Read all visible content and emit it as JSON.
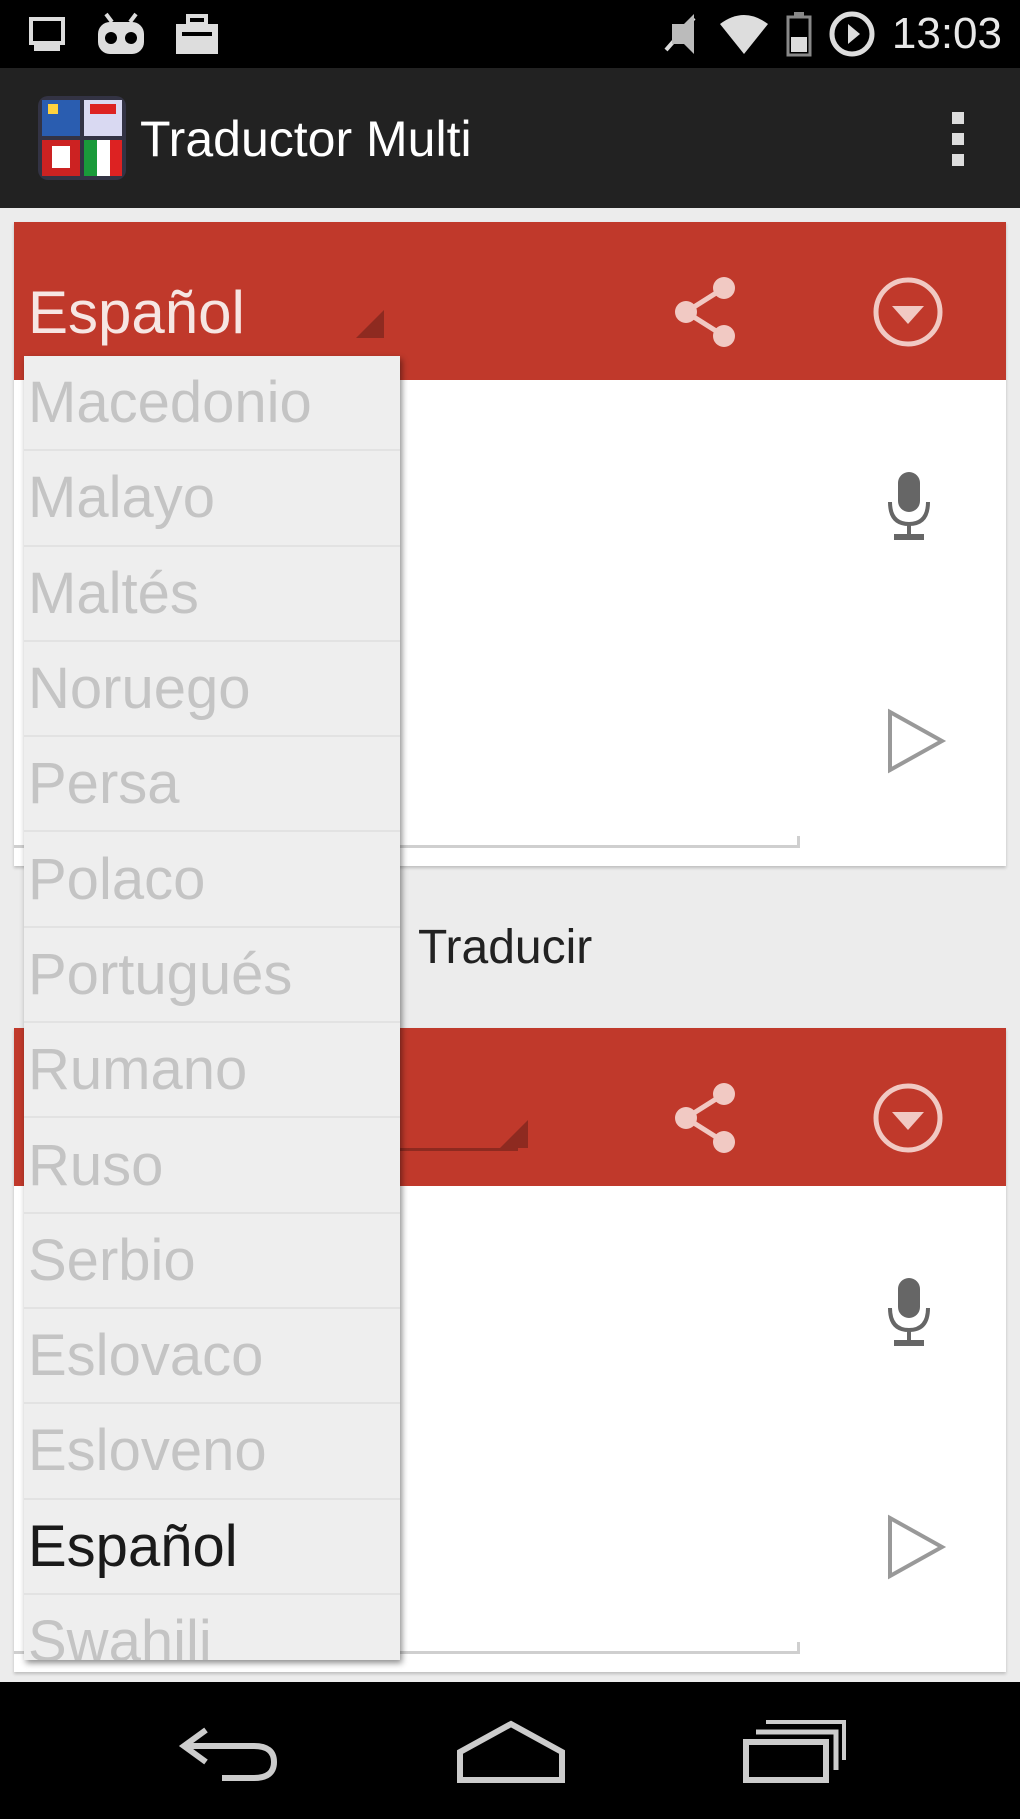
{
  "status_bar": {
    "time": "13:03",
    "icons": [
      "monitor-icon",
      "android-debug-icon",
      "briefcase-icon",
      "mute-icon",
      "wifi-icon",
      "battery-icon",
      "data-saver-icon"
    ]
  },
  "app_bar": {
    "title": "Traductor Multi",
    "icon": "flags-app-icon"
  },
  "source_panel": {
    "language": "Español",
    "share_icon": "share-icon",
    "dropdown_icon": "dropdown-circle-icon",
    "mic_icon": "microphone-icon",
    "play_icon": "play-icon"
  },
  "translate_button": {
    "label": "Traducir"
  },
  "target_panel": {
    "language": "",
    "share_icon": "share-icon",
    "dropdown_icon": "dropdown-circle-icon",
    "mic_icon": "microphone-icon",
    "play_icon": "play-icon"
  },
  "language_dropdown": {
    "items": [
      "Macedonio",
      "Malayo",
      "Maltés",
      "Noruego",
      "Persa",
      "Polaco",
      "Portugués",
      "Rumano",
      "Ruso",
      "Serbio",
      "Eslovaco",
      "Esloveno",
      "Español",
      "Swahili"
    ],
    "selected": "Español"
  },
  "nav_bar": {
    "buttons": [
      "back-icon",
      "home-icon",
      "recents-icon"
    ]
  },
  "colors": {
    "header_red": "#c0392b",
    "action_bar": "#222222",
    "status_bar": "#000000"
  }
}
